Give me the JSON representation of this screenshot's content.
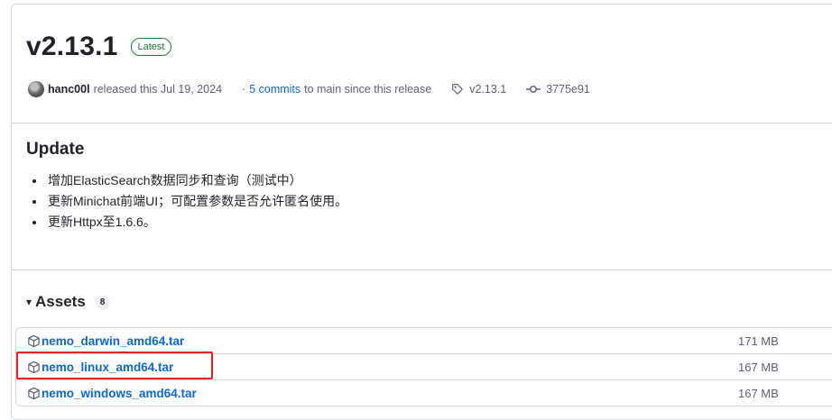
{
  "release": {
    "title": "v2.13.1",
    "badge": "Latest",
    "author": "hanc00l",
    "released_text": "released this Jul 19, 2024",
    "commits_prefix": "·",
    "commits_link": "5 commits",
    "commits_suffix": "to main since this release",
    "tag": "v2.13.1",
    "commit_hash": "3775e91"
  },
  "notes": {
    "heading": "Update",
    "items": [
      "增加ElasticSearch数据同步和查询（测试中）",
      "更新Minichat前端UI；可配置参数是否允许匿名使用。",
      "更新Httpx至1.6.6。"
    ]
  },
  "assets": {
    "heading": "Assets",
    "count": "8",
    "caret": "▾",
    "files": [
      {
        "name": "nemo_darwin_amd64.tar",
        "size": "171 MB"
      },
      {
        "name": "nemo_linux_amd64.tar",
        "size": "167 MB"
      },
      {
        "name": "nemo_windows_amd64.tar",
        "size": "167 MB"
      }
    ]
  },
  "colors": {
    "link": "#0969da",
    "badge_green": "#1a7f37",
    "highlight_red": "#e02424"
  },
  "icons": {
    "tag": "tag-icon",
    "commit": "git-commit-icon",
    "package": "package-icon"
  }
}
